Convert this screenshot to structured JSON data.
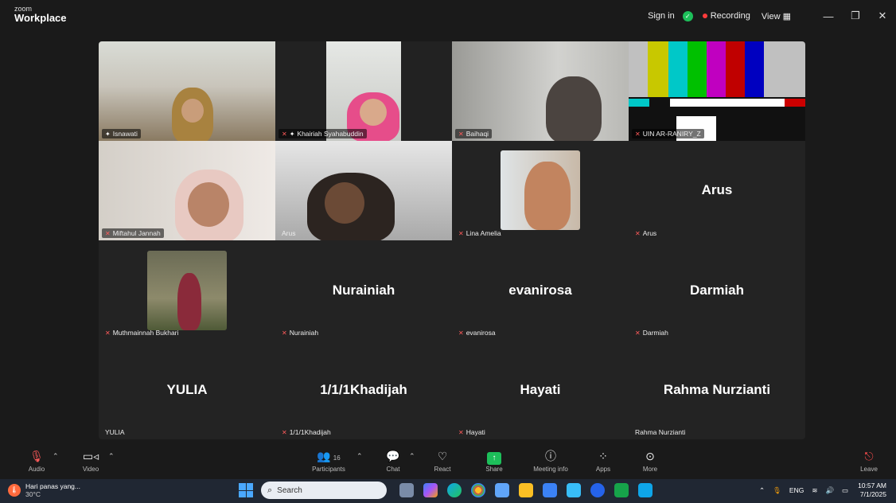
{
  "app": {
    "brand_small": "zoom",
    "brand_big": "Workplace"
  },
  "titlebar": {
    "signin": "Sign in",
    "recording": "Recording",
    "view": "View",
    "minimize": "—",
    "restore": "❐",
    "close": "✕"
  },
  "tiles": [
    {
      "name": "Isnawati",
      "bigname": "",
      "video": true
    },
    {
      "name": "Khairiah Syahabuddin",
      "bigname": "",
      "video": true
    },
    {
      "name": "Baihaqi",
      "bigname": "",
      "video": true
    },
    {
      "name": "UIN AR-RANIRY_Z",
      "bigname": "",
      "video": true
    },
    {
      "name": "Miftahul Jannah",
      "bigname": "",
      "video": true
    },
    {
      "name": "Arus",
      "bigname": "",
      "video": true
    },
    {
      "name": "Lina Amelia",
      "bigname": "",
      "video": false
    },
    {
      "name": "Arus",
      "bigname": "Arus",
      "video": false
    },
    {
      "name": "Muthmainnah Bukhari",
      "bigname": "",
      "video": false
    },
    {
      "name": "Nurainiah",
      "bigname": "Nurainiah",
      "video": false
    },
    {
      "name": "evanirosa",
      "bigname": "evanirosa",
      "video": false
    },
    {
      "name": "Darmiah",
      "bigname": "Darmiah",
      "video": false
    },
    {
      "name": "YULIA",
      "bigname": "YULIA",
      "video": false
    },
    {
      "name": "1/1/1Khadijah",
      "bigname": "1/1/1Khadijah",
      "video": false
    },
    {
      "name": "Hayati",
      "bigname": "Hayati",
      "video": false
    },
    {
      "name": "Rahma Nurzianti",
      "bigname": "Rahma Nurzianti",
      "video": false
    }
  ],
  "toolbar": {
    "audio": "Audio",
    "video": "Video",
    "participants": "Participants",
    "participants_count": "16",
    "chat": "Chat",
    "react": "React",
    "share": "Share",
    "meeting_info": "Meeting info",
    "apps": "Apps",
    "more": "More",
    "leave": "Leave"
  },
  "taskbar": {
    "weather_text": "Hari panas yang...",
    "temperature": "30°C",
    "search_placeholder": "Search",
    "language": "ENG",
    "time": "10:57 AM",
    "date": "7/1/2025"
  }
}
